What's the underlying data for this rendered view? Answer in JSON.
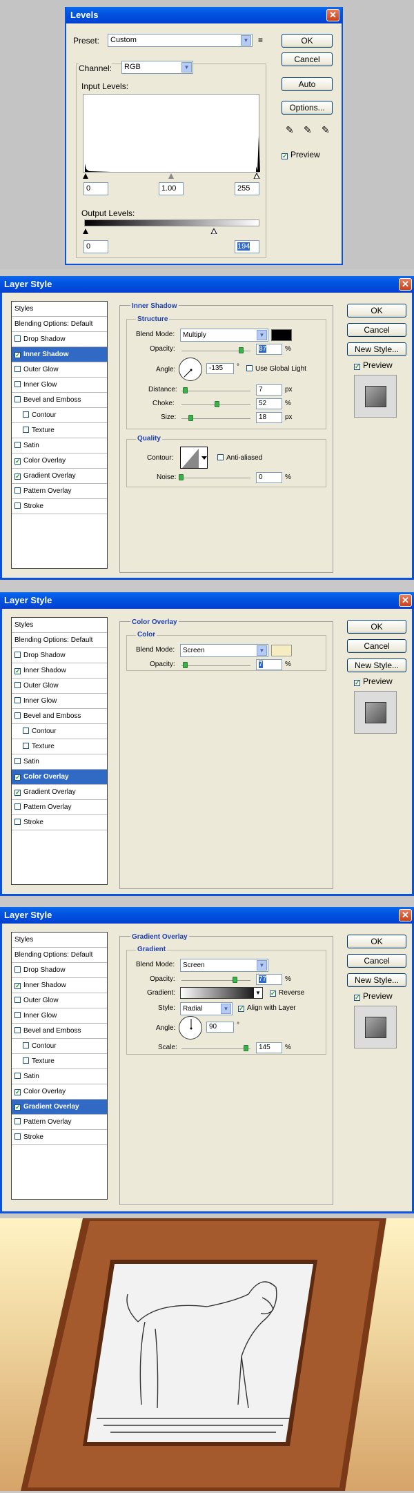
{
  "levels": {
    "title": "Levels",
    "preset_label": "Preset:",
    "preset_value": "Custom",
    "channel_label": "Channel:",
    "channel_value": "RGB",
    "input_label": "Input Levels:",
    "input_black": "0",
    "input_gamma": "1.00",
    "input_white": "255",
    "output_label": "Output Levels:",
    "output_black": "0",
    "output_white": "194",
    "ok": "OK",
    "cancel": "Cancel",
    "auto": "Auto",
    "options": "Options...",
    "preview": "Preview"
  },
  "list_items": [
    "Styles",
    "Blending Options: Default",
    "Drop Shadow",
    "Inner Shadow",
    "Outer Glow",
    "Inner Glow",
    "Bevel and Emboss",
    "Contour",
    "Texture",
    "Satin",
    "Color Overlay",
    "Gradient Overlay",
    "Pattern Overlay",
    "Stroke"
  ],
  "ls1": {
    "title": "Layer Style",
    "section": "Inner Shadow",
    "structure": "Structure",
    "blend_label": "Blend Mode:",
    "blend": "Multiply",
    "opacity_label": "Opacity:",
    "opacity": "87",
    "angle_label": "Angle:",
    "angle": "-135",
    "deg": "°",
    "global_light": "Use Global Light",
    "distance_label": "Distance:",
    "distance": "7",
    "choke_label": "Choke:",
    "choke": "52",
    "size_label": "Size:",
    "size": "18",
    "quality": "Quality",
    "contour_label": "Contour:",
    "antialiased": "Anti-aliased",
    "noise_label": "Noise:",
    "noise": "0",
    "pct": "%",
    "px": "px",
    "ok": "OK",
    "cancel": "Cancel",
    "newstyle": "New Style...",
    "preview": "Preview"
  },
  "ls2": {
    "title": "Layer Style",
    "section": "Color Overlay",
    "sub": "Color",
    "blend_label": "Blend Mode:",
    "blend": "Screen",
    "opacity_label": "Opacity:",
    "opacity": "7",
    "pct": "%",
    "ok": "OK",
    "cancel": "Cancel",
    "newstyle": "New Style...",
    "preview": "Preview"
  },
  "ls3": {
    "title": "Layer Style",
    "section": "Gradient Overlay",
    "sub": "Gradient",
    "blend_label": "Blend Mode:",
    "blend": "Screen",
    "opacity_label": "Opacity:",
    "opacity": "77",
    "gradient_label": "Gradient:",
    "reverse": "Reverse",
    "style_label": "Style:",
    "style": "Radial",
    "align": "Align with Layer",
    "angle_label": "Angle:",
    "angle": "90",
    "deg": "°",
    "scale_label": "Scale:",
    "scale": "145",
    "pct": "%",
    "ok": "OK",
    "cancel": "Cancel",
    "newstyle": "New Style...",
    "preview": "Preview"
  },
  "colors": {
    "accent": "#316ac5",
    "title": "#0054e3",
    "overlay": "#f5edc0"
  },
  "icons": [
    "close-icon",
    "chevron-down-icon",
    "eyedropper-icon",
    "checkbox-icon",
    "dial-icon"
  ]
}
